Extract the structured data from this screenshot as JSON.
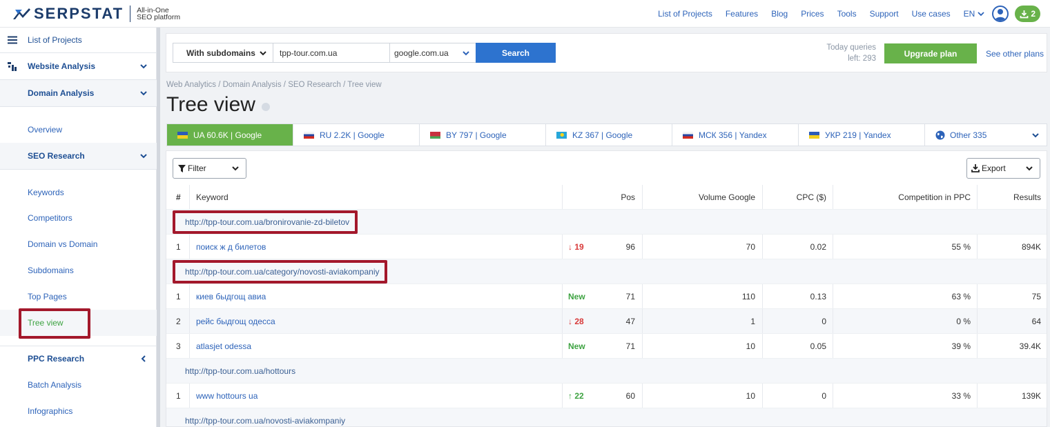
{
  "topbar": {
    "logo_text": "SERPSTAT",
    "logo_tagline_1": "All-in-One",
    "logo_tagline_2": "SEO platform",
    "nav": [
      "List of Projects",
      "Features",
      "Blog",
      "Prices",
      "Tools",
      "Support",
      "Use cases"
    ],
    "lang": "EN",
    "download_count": "2"
  },
  "sidebar": {
    "list_of_projects": "List of Projects",
    "website_analysis": "Website Analysis",
    "domain_analysis": "Domain Analysis",
    "overview": "Overview",
    "seo_research": "SEO Research",
    "keywords": "Keywords",
    "competitors": "Competitors",
    "domain_vs_domain": "Domain vs Domain",
    "subdomains": "Subdomains",
    "top_pages": "Top Pages",
    "tree_view": "Tree view",
    "ppc_research": "PPC Research",
    "batch_analysis": "Batch Analysis",
    "infographics": "Infographics"
  },
  "search": {
    "mode": "With subdomains",
    "domain": "tpp-tour.com.ua",
    "engine": "google.com.ua",
    "button": "Search",
    "queries_label": "Today queries",
    "queries_left": "left: 293",
    "upgrade": "Upgrade plan",
    "other_plans": "See other plans"
  },
  "breadcrumb": "Web Analytics / Domain Analysis / SEO Research / Tree view",
  "title": "Tree view",
  "tabs": [
    {
      "label": "UA 60.6K | Google",
      "flag": "ua"
    },
    {
      "label": "RU 2.2K | Google",
      "flag": "ru"
    },
    {
      "label": "BY 797 | Google",
      "flag": "by"
    },
    {
      "label": "KZ 367 | Google",
      "flag": "kz"
    },
    {
      "label": "МСК 356 | Yandex",
      "flag": "ru"
    },
    {
      "label": "УКР 219 | Yandex",
      "flag": "ua"
    },
    {
      "label": "Other 335",
      "flag": "globe"
    }
  ],
  "toolbar": {
    "filter": "Filter",
    "export": "Export"
  },
  "table": {
    "headers": [
      "#",
      "Keyword",
      "Pos",
      "Volume Google",
      "CPC ($)",
      "Competition in PPC",
      "Results"
    ],
    "groups": [
      {
        "url": "http://tpp-tour.com.ua/bronirovanie-zd-biletov",
        "highlight": true,
        "rows": [
          {
            "n": "1",
            "kw": "поиск ж д билетов",
            "change": "↓ 19",
            "dir": "down",
            "pos": "96",
            "vol": "70",
            "cpc": "0.02",
            "comp": "55 %",
            "res": "894K"
          }
        ]
      },
      {
        "url": "http://tpp-tour.com.ua/category/novosti-aviakompaniy",
        "highlight": true,
        "rows": [
          {
            "n": "1",
            "kw": "киев быдгощ авиа",
            "change": "New",
            "dir": "new",
            "pos": "71",
            "vol": "110",
            "cpc": "0.13",
            "comp": "63 %",
            "res": "75"
          },
          {
            "n": "2",
            "kw": "рейс быдгощ одесса",
            "change": "↓ 28",
            "dir": "down",
            "pos": "47",
            "vol": "1",
            "cpc": "0",
            "comp": "0 %",
            "res": "64"
          },
          {
            "n": "3",
            "kw": "atlasjet odessa",
            "change": "New",
            "dir": "new",
            "pos": "71",
            "vol": "10",
            "cpc": "0.05",
            "comp": "39 %",
            "res": "39.4K"
          }
        ]
      },
      {
        "url": "http://tpp-tour.com.ua/hottours",
        "highlight": false,
        "rows": [
          {
            "n": "1",
            "kw": "www hottours ua",
            "change": "↑ 22",
            "dir": "up",
            "pos": "60",
            "vol": "10",
            "cpc": "0",
            "comp": "33 %",
            "res": "139K"
          }
        ]
      },
      {
        "url": "http://tpp-tour.com.ua/novosti-aviakompaniy",
        "highlight": false,
        "rows": []
      }
    ]
  },
  "colors": {
    "accent_green": "#68b24a",
    "link_blue": "#2d63b9",
    "highlight_red": "#a3182b",
    "search_blue": "#2d73cf"
  }
}
